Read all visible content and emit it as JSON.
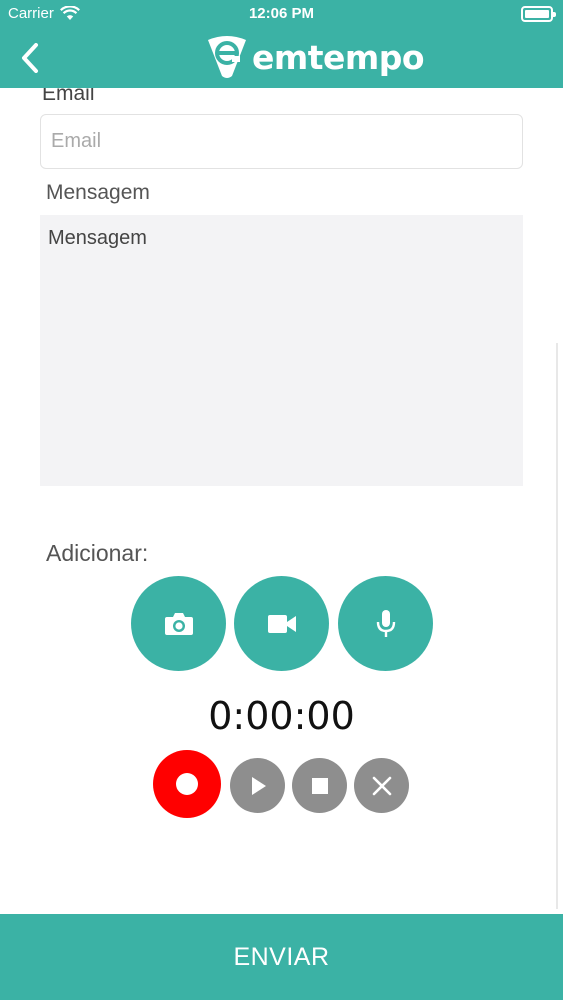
{
  "status_bar": {
    "carrier": "Carrier",
    "time": "12:06 PM"
  },
  "nav": {
    "logo_text": "emtempo",
    "brand_color": "#3bb2a5"
  },
  "form": {
    "email_label": "Email",
    "email_placeholder": "Email",
    "message_label": "Mensagem",
    "message_placeholder": "Mensagem",
    "add_label": "Adicionar:"
  },
  "media": {
    "buttons": [
      "camera-icon",
      "video-icon",
      "microphone-icon"
    ]
  },
  "recorder": {
    "timer": "0:00:00",
    "record_color": "#ff0000",
    "controls": [
      "record",
      "play",
      "stop",
      "cancel"
    ]
  },
  "footer": {
    "send_label": "ENVIAR"
  }
}
